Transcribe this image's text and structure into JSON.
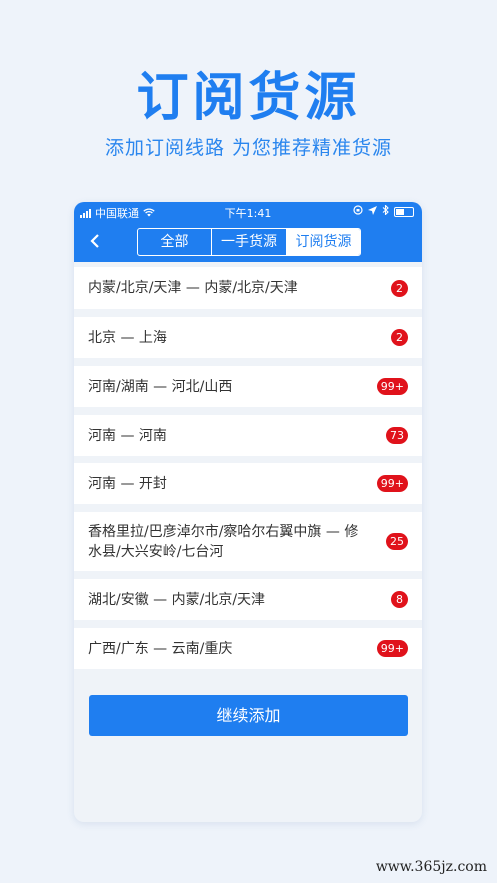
{
  "hero": {
    "title": "订阅货源",
    "subtitle": "添加订阅线路 为您推荐精准货源"
  },
  "statusbar": {
    "carrier": "中国联通",
    "time": "下午1:41"
  },
  "tabs": [
    {
      "label": "全部",
      "active": false
    },
    {
      "label": "一手货源",
      "active": false
    },
    {
      "label": "订阅货源",
      "active": true
    }
  ],
  "routes": [
    {
      "text": "内蒙/北京/天津 — 内蒙/北京/天津",
      "badge": "2"
    },
    {
      "text": "北京 — 上海",
      "badge": "2"
    },
    {
      "text": "河南/湖南 — 河北/山西",
      "badge": "99+"
    },
    {
      "text": "河南 — 河南",
      "badge": "73"
    },
    {
      "text": "河南 — 开封",
      "badge": "99+"
    },
    {
      "text": "香格里拉/巴彦淖尔市/察哈尔右翼中旗 — 修水县/大兴安岭/七台河",
      "badge": "25"
    },
    {
      "text": "湖北/安徽 — 内蒙/北京/天津",
      "badge": "8"
    },
    {
      "text": "广西/广东 — 云南/重庆",
      "badge": "99+"
    }
  ],
  "continue_button": "继续添加",
  "watermark": "www.365jz.com",
  "colors": {
    "primary": "#1f7ef0",
    "badge": "#e0121b",
    "background": "#eef3fa"
  }
}
